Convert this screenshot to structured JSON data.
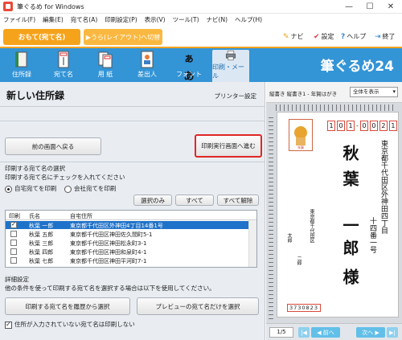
{
  "window": {
    "title": "筆ぐるめ for Windows",
    "minimize": "—",
    "maximize": "☐",
    "close": "✕"
  },
  "menu": [
    "ファイル(F)",
    "編集(E)",
    "宛て名(A)",
    "印刷設定(P)",
    "表示(V)",
    "ツール(T)",
    "ナビ(N)",
    "ヘルプ(H)"
  ],
  "mode": {
    "front": "おもて(宛て名)",
    "back": "▶うら(レイアウト)へ切替",
    "right": [
      {
        "icon": "navi-icon",
        "label": "ナビ"
      },
      {
        "icon": "settings-icon",
        "label": "設定"
      },
      {
        "icon": "help-icon",
        "label": "ヘルプ"
      },
      {
        "icon": "exit-icon",
        "label": "終了"
      }
    ]
  },
  "toolbar": {
    "tools": [
      "住所録",
      "宛て名",
      "用 紙",
      "差出人",
      "フォント",
      "印刷・メール"
    ],
    "font_icon_text": "ぁあ",
    "brand": "筆ぐるめ24",
    "colors": {
      "bar": "#3394d6",
      "accent": "#f6a31c"
    }
  },
  "left": {
    "title": "新しい住所録",
    "printer_setting": "プリンター設定",
    "back_button": "前の画面へ戻る",
    "exec_button": "印刷実行画面へ進む",
    "select_section": "印刷する宛て名の選択",
    "select_hint": "印刷する宛て名にチェックを入れてください",
    "radio_home": "自宅宛てを印刷",
    "radio_company": "会社宛てを印刷",
    "btn_selected_only": "選択のみ",
    "btn_all": "すべて",
    "btn_clear_all": "すべて解除",
    "table": {
      "headers": [
        "印刷",
        "氏名",
        "自宅住所"
      ],
      "rows": [
        {
          "checked": true,
          "name": "秋葉 一郎",
          "address": "東京都千代田区外神田4丁目14番1号",
          "selected": true
        },
        {
          "checked": false,
          "name": "秋葉 五郎",
          "address": "東京都千代田区神田佐久間町5-1",
          "selected": false
        },
        {
          "checked": false,
          "name": "秋葉 三郎",
          "address": "東京都千代田区神田松永町3-1",
          "selected": false
        },
        {
          "checked": false,
          "name": "秋葉 四郎",
          "address": "東京都千代田区神田和泉町4-1",
          "selected": false
        },
        {
          "checked": false,
          "name": "秋葉 七郎",
          "address": "東京都千代田区神田平河町7-1",
          "selected": false
        }
      ]
    },
    "detail_section": "詳細設定",
    "detail_hint": "他の条件を使って印刷する宛て名を選択する場合は以下を使用してください。",
    "btn_history": "印刷する宛て名を履歴から選択",
    "btn_preview_select": "プレビューの宛て名だけを選択",
    "skip_no_address": "住所が入力されていない宛て名は印刷しない"
  },
  "preview": {
    "layout_label": "縦書き 縦書き1 - 年賀はがき",
    "view_select": "全体を表示",
    "zip": [
      "1",
      "0",
      "1",
      "-",
      "0",
      "0",
      "2",
      "1"
    ],
    "address_col1": "東京都千代田区外神田四丁目",
    "address_col2": "十四番一号",
    "name_family": "秋葉",
    "name_given": "一郎",
    "honorific": "様",
    "sender_address": "東京都千代田区",
    "sender_name1": "二郎",
    "sender_name2": "太郎",
    "sender_zip": "3730823",
    "page": "1/5",
    "prev": "◀ 前へ",
    "next": "次へ ▶"
  }
}
